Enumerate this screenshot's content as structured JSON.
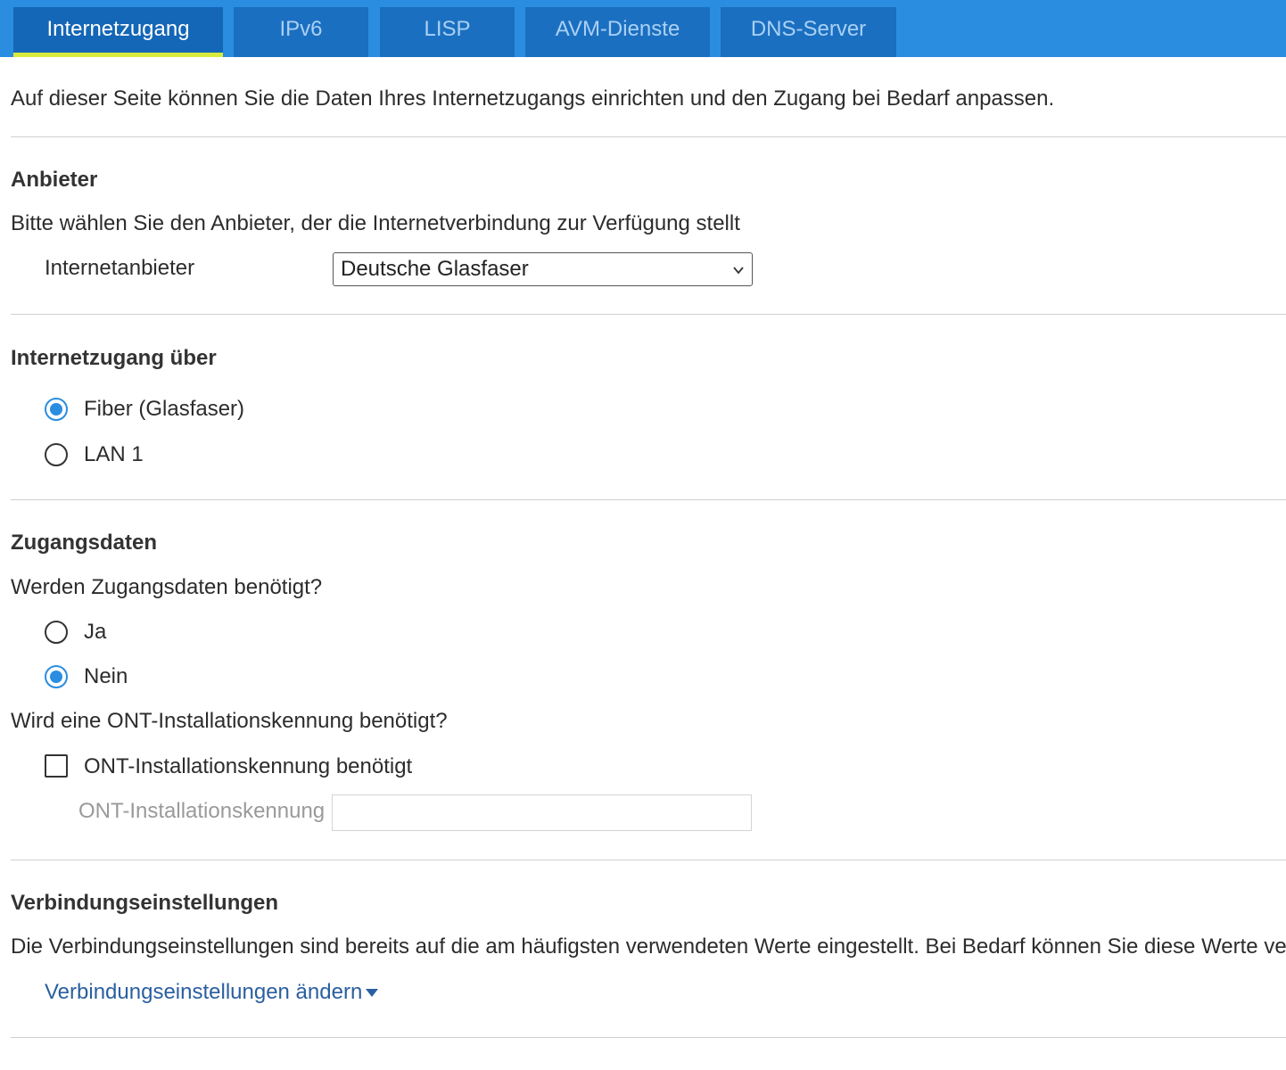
{
  "tabs": {
    "internet": "Internetzugang",
    "ipv6": "IPv6",
    "lisp": "LISP",
    "avm": "AVM-Dienste",
    "dns": "DNS-Server"
  },
  "intro": "Auf dieser Seite können Sie die Daten Ihres Internetzugangs einrichten und den Zugang bei Bedarf anpassen.",
  "provider": {
    "heading": "Anbieter",
    "description": "Bitte wählen Sie den Anbieter, der die Internetverbindung zur Verfügung stellt",
    "label": "Internetanbieter",
    "selected": "Deutsche Glasfaser"
  },
  "access": {
    "heading": "Internetzugang über",
    "options": [
      {
        "label": "Fiber (Glasfaser)",
        "checked": true
      },
      {
        "label": "LAN 1",
        "checked": false
      }
    ]
  },
  "credentials": {
    "heading": "Zugangsdaten",
    "question": "Werden Zugangsdaten benötigt?",
    "options": [
      {
        "label": "Ja",
        "checked": false
      },
      {
        "label": "Nein",
        "checked": true
      }
    ],
    "ont_question": "Wird eine ONT-Installationskennung benötigt?",
    "ont_checkbox_label": "ONT-Installationskennung benötigt",
    "ont_checked": false,
    "ont_field_label": "ONT-Installationskennung",
    "ont_field_value": ""
  },
  "connection": {
    "heading": "Verbindungseinstellungen",
    "description": "Die Verbindungseinstellungen sind bereits auf die am häufigsten verwendeten Werte eingestellt. Bei Bedarf können Sie diese Werte verän",
    "link": "Verbindungseinstellungen ändern"
  },
  "colors": {
    "tabbar": "#2b8de0",
    "tab": "#1b6fc0",
    "active_underline": "#d8ea3c",
    "radio_checked": "#2b8de0",
    "link": "#2a5fa0"
  }
}
